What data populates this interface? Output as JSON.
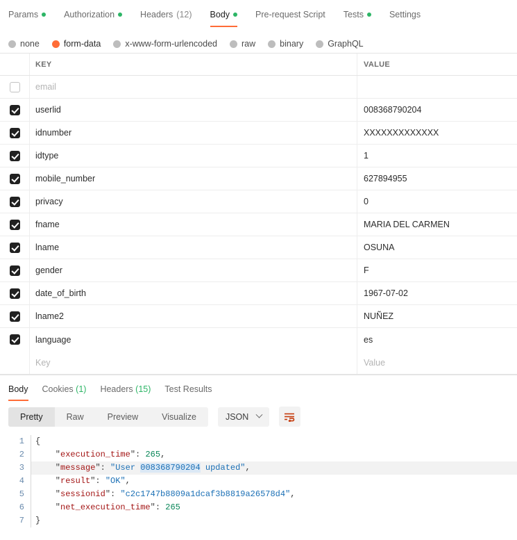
{
  "request_tabs": [
    {
      "label": "Params",
      "dot": true,
      "count": "",
      "active": false
    },
    {
      "label": "Authorization",
      "dot": true,
      "count": "",
      "active": false
    },
    {
      "label": "Headers",
      "dot": false,
      "count": "(12)",
      "active": false
    },
    {
      "label": "Body",
      "dot": true,
      "count": "",
      "active": true
    },
    {
      "label": "Pre-request Script",
      "dot": false,
      "count": "",
      "active": false
    },
    {
      "label": "Tests",
      "dot": true,
      "count": "",
      "active": false
    },
    {
      "label": "Settings",
      "dot": false,
      "count": "",
      "active": false
    }
  ],
  "body_types": [
    {
      "label": "none",
      "selected": false
    },
    {
      "label": "form-data",
      "selected": true
    },
    {
      "label": "x-www-form-urlencoded",
      "selected": false
    },
    {
      "label": "raw",
      "selected": false
    },
    {
      "label": "binary",
      "selected": false
    },
    {
      "label": "GraphQL",
      "selected": false
    }
  ],
  "table": {
    "headers": {
      "key": "KEY",
      "value": "VALUE"
    },
    "rows": [
      {
        "checked": false,
        "key": "email",
        "value": "",
        "placeholder": true
      },
      {
        "checked": true,
        "key": "userlid",
        "value": "008368790204",
        "placeholder": false
      },
      {
        "checked": true,
        "key": "idnumber",
        "value": "XXXXXXXXXXXXX",
        "placeholder": false
      },
      {
        "checked": true,
        "key": "idtype",
        "value": "1",
        "placeholder": false
      },
      {
        "checked": true,
        "key": "mobile_number",
        "value": "627894955",
        "placeholder": false
      },
      {
        "checked": true,
        "key": "privacy",
        "value": "0",
        "placeholder": false
      },
      {
        "checked": true,
        "key": "fname",
        "value": "MARIA DEL CARMEN",
        "placeholder": false
      },
      {
        "checked": true,
        "key": "lname",
        "value": "OSUNA",
        "placeholder": false
      },
      {
        "checked": true,
        "key": "gender",
        "value": "F",
        "placeholder": false
      },
      {
        "checked": true,
        "key": "date_of_birth",
        "value": "1967-07-02",
        "placeholder": false
      },
      {
        "checked": true,
        "key": "lname2",
        "value": "NUÑEZ",
        "placeholder": false
      },
      {
        "checked": true,
        "key": "language",
        "value": "es",
        "placeholder": false
      }
    ],
    "empty_row": {
      "key_placeholder": "Key",
      "value_placeholder": "Value"
    }
  },
  "response_tabs": [
    {
      "label": "Body",
      "count": "",
      "active": true
    },
    {
      "label": "Cookies",
      "count": "(1)",
      "active": false
    },
    {
      "label": "Headers",
      "count": "(15)",
      "active": false
    },
    {
      "label": "Test Results",
      "count": "",
      "active": false
    }
  ],
  "view_modes": [
    {
      "label": "Pretty",
      "active": true
    },
    {
      "label": "Raw",
      "active": false
    },
    {
      "label": "Preview",
      "active": false
    },
    {
      "label": "Visualize",
      "active": false
    }
  ],
  "format_selected": "JSON",
  "icons": {
    "chevron_down": "chevron-down-icon",
    "word_wrap": "word-wrap-icon"
  },
  "response_body": {
    "line_numbers": [
      "1",
      "2",
      "3",
      "4",
      "5",
      "6",
      "7"
    ],
    "fields": {
      "execution_time_key": "execution_time",
      "execution_time_value": "265",
      "message_key": "message",
      "message_prefix": "User ",
      "message_userid": "008368790204",
      "message_suffix": " updated",
      "result_key": "result",
      "result_value": "OK",
      "sessionid_key": "sessionid",
      "sessionid_value": "c2c1747b8809a1dcaf3b8819a26578d4",
      "net_execution_time_key": "net_execution_time",
      "net_execution_time_value": "265"
    }
  },
  "colors": {
    "accent": "#ff6c37",
    "dot_green": "#2db566",
    "json_key": "#a31515",
    "json_string": "#1a6fb5",
    "json_number": "#098658"
  }
}
